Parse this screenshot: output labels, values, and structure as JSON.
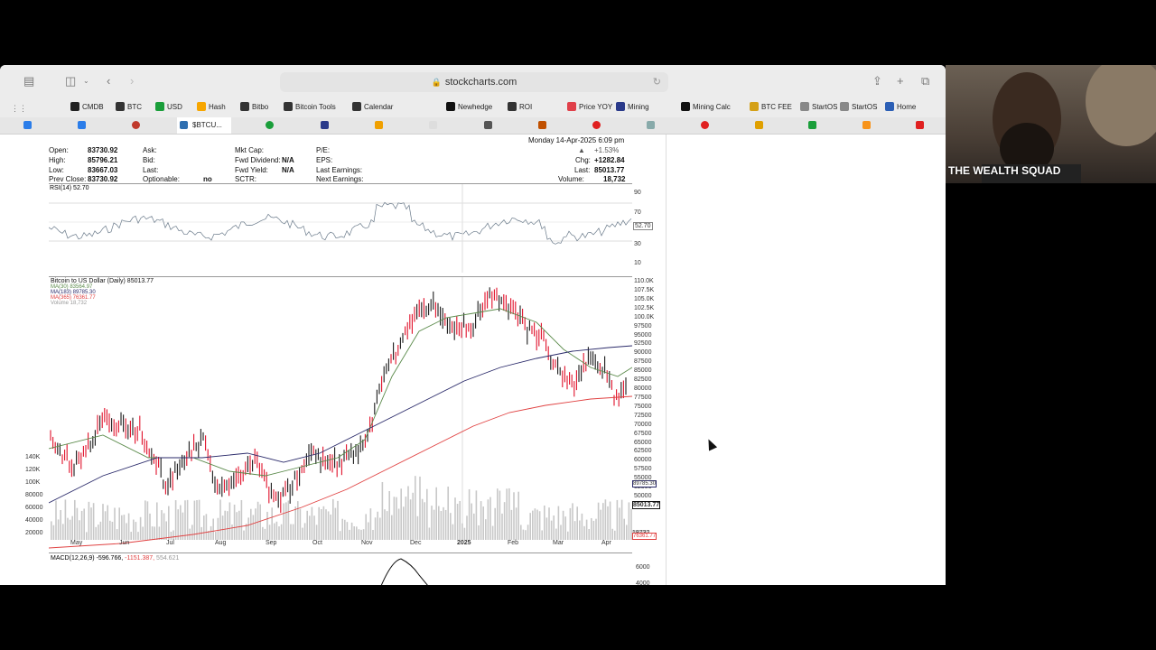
{
  "browser": {
    "url": "stockcharts.com",
    "bookmarks": [
      {
        "label": "CMDB",
        "color": "#222"
      },
      {
        "label": "BTC",
        "color": "#333"
      },
      {
        "label": "USD",
        "color": "#1a9e3a"
      },
      {
        "label": "Hash",
        "color": "#f7a600"
      },
      {
        "label": "Bitbo",
        "color": "#333"
      },
      {
        "label": "Bitcoin Tools",
        "color": "#333"
      },
      {
        "label": "Calendar",
        "color": "#333"
      },
      {
        "label": "Newhedge",
        "color": "#111"
      },
      {
        "label": "ROI",
        "color": "#333"
      },
      {
        "label": "Price YOY",
        "color": "#e0404a"
      },
      {
        "label": "Mining",
        "color": "#2a3a8a"
      },
      {
        "label": "Mining Calc",
        "color": "#111"
      },
      {
        "label": "BTC FEE",
        "color": "#d4a017"
      },
      {
        "label": "StartOS",
        "color": "#888"
      },
      {
        "label": "StartOS",
        "color": "#888"
      },
      {
        "label": "Home",
        "color": "#2c5fb5"
      }
    ],
    "active_tab": "$BTCU..."
  },
  "quote": {
    "open_label": "Open:",
    "open": "83730.92",
    "high_label": "High:",
    "high": "85796.21",
    "low_label": "Low:",
    "low": "83667.03",
    "prev_close_label": "Prev Close:",
    "prev_close": "83730.92",
    "ask_label": "Ask:",
    "bid_label": "Bid:",
    "last_label": "Last:",
    "optionable_label": "Optionable:",
    "optionable": "no",
    "mktcap_label": "Mkt Cap:",
    "fwd_div_label": "Fwd Dividend:",
    "fwd_div": "N/A",
    "fwd_yield_label": "Fwd Yield:",
    "fwd_yield": "N/A",
    "sctr_label": "SCTR:",
    "pe_label": "P/E:",
    "eps_label": "EPS:",
    "last_earn_label": "Last Earnings:",
    "next_earn_label": "Next Earnings:",
    "date": "Monday 14-Apr-2025 6:09 pm",
    "pct_change": "+1.53%",
    "chg_label": "Chg:",
    "chg": "+1282.84",
    "last2_label": "Last:",
    "last": "85013.77",
    "volume_label": "Volume:",
    "volume": "18,732"
  },
  "rsi": {
    "label": "RSI(14) 52.70",
    "ticks": [
      "90",
      "70",
      "30",
      "10"
    ],
    "marker": "52.70"
  },
  "price_panel": {
    "title": "Bitcoin to US Dollar (Daily) 85013.77",
    "ma30": "MA(30) 83564.97",
    "ma183": "MA(183) 89785.30",
    "ma365": "MA(365) 76361.77",
    "volume": "Volume 18,732",
    "right_ticks": [
      "110.0K",
      "107.5K",
      "105.0K",
      "102.5K",
      "100.0K",
      "97500",
      "95000",
      "92500",
      "90000",
      "87500",
      "85000",
      "82500",
      "80000",
      "77500",
      "75000",
      "72500",
      "70000",
      "67500",
      "65000",
      "62500",
      "60000",
      "57500",
      "55000",
      "52500",
      "50000"
    ],
    "left_ticks": [
      "140K",
      "120K",
      "100K",
      "80000",
      "60000",
      "40000",
      "20000"
    ],
    "vol_right": "18732",
    "ma183_badge": "89785.30",
    "last_badge": "85013.77",
    "ma365_badge": "76361.77",
    "months": [
      "May",
      "Jun",
      "Jul",
      "Aug",
      "Sep",
      "Oct",
      "Nov",
      "Dec",
      "2025",
      "Feb",
      "Mar",
      "Apr"
    ]
  },
  "macd": {
    "label_main": "MACD(12,26,9)",
    "label_v1": "-596.766,",
    "label_v2": "-1151.387,",
    "label_v3": "554.621",
    "ticks": [
      "6000",
      "4000"
    ]
  },
  "webcam": {
    "label": "THE WEALTH SQUAD"
  },
  "colors": {
    "bull": "#1a1a1a",
    "bear": "#e0102a",
    "ma30": "#5a8a4a",
    "ma183": "#2a2a6a",
    "ma365": "#e04040",
    "volume": "#c8c8c8",
    "rsi": "#6a7a8a"
  }
}
